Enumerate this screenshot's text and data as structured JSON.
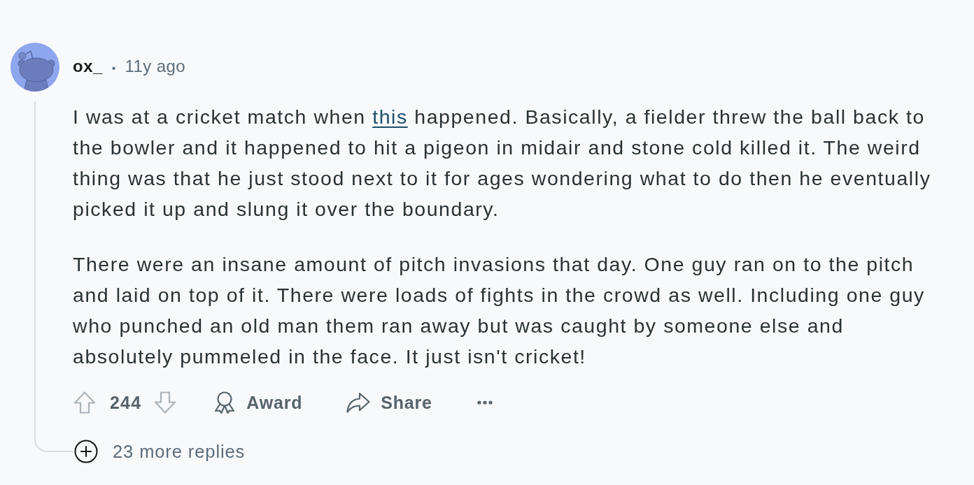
{
  "comment": {
    "author": "ox_",
    "separator": "•",
    "age": "11y ago",
    "paragraphs": [
      {
        "parts": [
          {
            "kind": "text",
            "text": "I was at a cricket match when "
          },
          {
            "kind": "link",
            "text": "this"
          },
          {
            "kind": "text",
            "text": " happened. Basically, a fielder threw the ball back to the bowler and it happened to hit a pigeon in midair and stone cold killed it. The weird thing was that he just stood next to it for ages wondering what to do then he eventually picked it up and slung it over the boundary."
          }
        ]
      },
      {
        "parts": [
          {
            "kind": "text",
            "text": "There were an insane amount of pitch invasions that day. One guy ran on to the pitch and laid on top of it. There were loads of fights in the crowd as well. Including one guy who punched an old man them ran away but was caught by someone else and absolutely pummeled in the face. It just isn't cricket!"
          }
        ]
      }
    ],
    "actions": {
      "score": "244",
      "upvoted": false,
      "downvoted": false,
      "award_label": "Award",
      "share_label": "Share"
    },
    "replies": {
      "label": "23 more replies",
      "expanded": false
    }
  }
}
